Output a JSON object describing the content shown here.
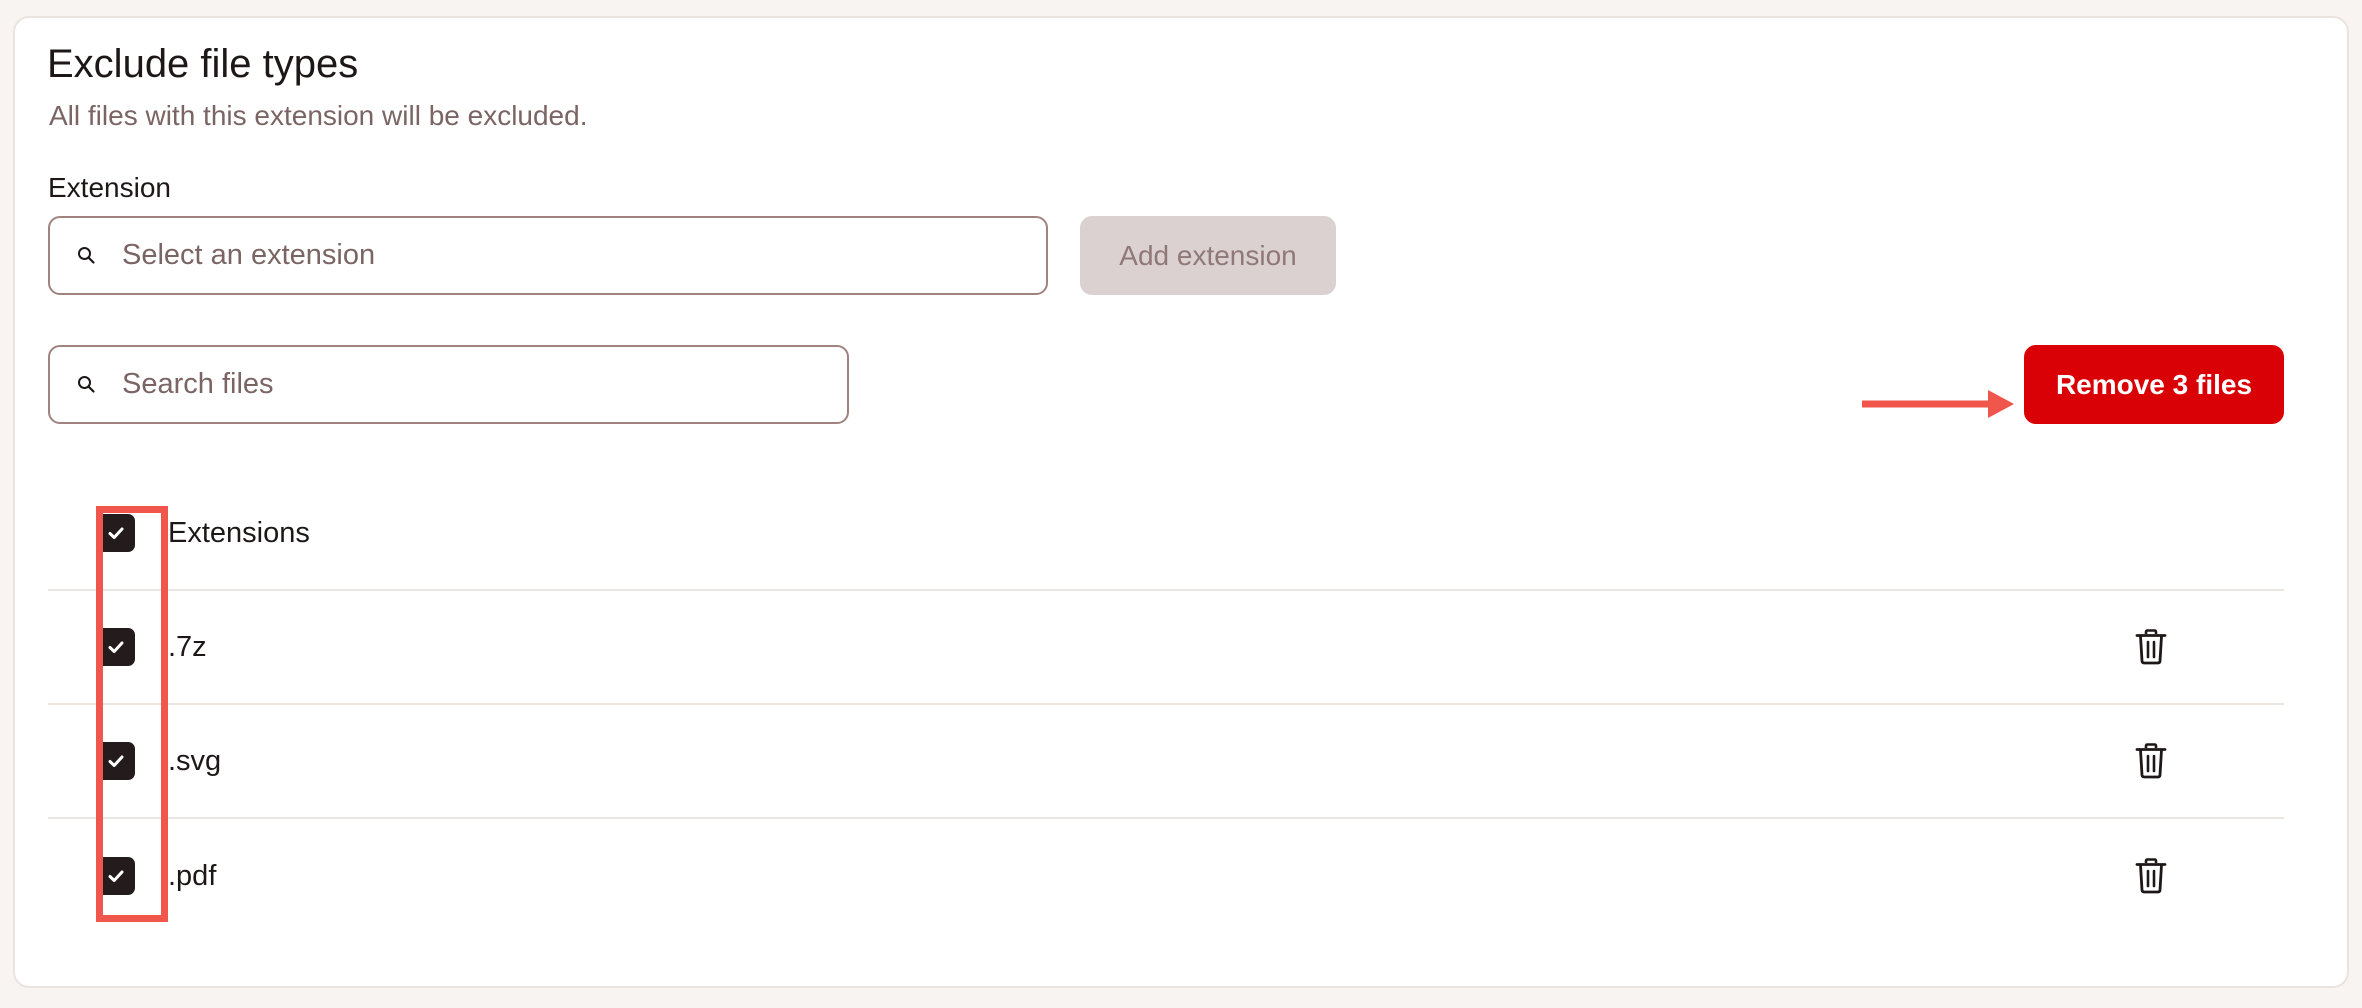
{
  "panel": {
    "title": "Exclude file types",
    "subtitle": "All files with this extension will be excluded."
  },
  "extension_field": {
    "label": "Extension",
    "placeholder": "Select an extension",
    "value": ""
  },
  "add_button": {
    "label": "Add extension",
    "state": "disabled"
  },
  "file_search": {
    "placeholder": "Search files",
    "value": ""
  },
  "remove_button": {
    "label": "Remove 3 files",
    "color": "#d90106"
  },
  "table": {
    "header": {
      "label": "Extensions",
      "checked": true
    },
    "rows": [
      {
        "extension": ".7z",
        "checked": true,
        "action_icon": "trash-icon"
      },
      {
        "extension": ".svg",
        "checked": true,
        "action_icon": "trash-icon"
      },
      {
        "extension": ".pdf",
        "checked": true,
        "action_icon": "trash-icon"
      }
    ]
  },
  "annotations": {
    "highlight_color": "#f0564b",
    "arrow_color": "#f0564b"
  }
}
